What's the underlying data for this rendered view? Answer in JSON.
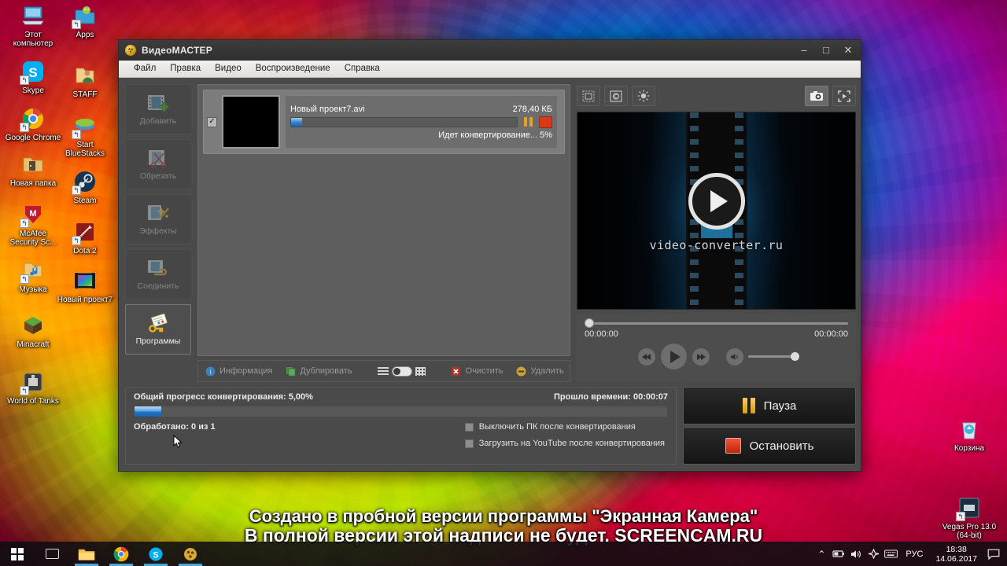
{
  "desktop": {
    "icons_left": [
      {
        "label": "Этот компьютер",
        "icon": "computer-icon",
        "shortcut": false
      },
      {
        "label": "Apps",
        "icon": "folder-apps-icon",
        "shortcut": true
      },
      {
        "label": "Skype",
        "icon": "skype-icon",
        "shortcut": true
      },
      {
        "label": "STAFF",
        "icon": "folder-staff-icon",
        "shortcut": false
      },
      {
        "label": "Google Chrome",
        "icon": "chrome-icon",
        "shortcut": true
      },
      {
        "label": "Start BlueStacks",
        "icon": "bluestacks-icon",
        "shortcut": true
      },
      {
        "label": "Новая папка",
        "icon": "folder-icon",
        "shortcut": false
      },
      {
        "label": "Steam",
        "icon": "steam-icon",
        "shortcut": true
      },
      {
        "label": "McAfee Security Sc...",
        "icon": "mcafee-icon",
        "shortcut": true
      },
      {
        "label": "Dota 2",
        "icon": "dota2-icon",
        "shortcut": true
      },
      {
        "label": "Музыка",
        "icon": "music-folder-icon",
        "shortcut": true
      },
      {
        "label": "Новый проект7",
        "icon": "video-file-icon",
        "shortcut": false
      },
      {
        "label": "Minacraft",
        "icon": "minecraft-icon",
        "shortcut": false
      },
      {
        "label": "World of Tanks",
        "icon": "wot-icon",
        "shortcut": true
      }
    ],
    "icons_right": [
      {
        "label": "Корзина",
        "icon": "recycle-bin-icon",
        "shortcut": false
      },
      {
        "label": "Vegas Pro 13.0 (64-bit)",
        "icon": "vegas-pro-icon",
        "shortcut": true
      }
    ]
  },
  "watermark": {
    "line1": "Создано в пробной версии программы \"Экранная Камера\"",
    "line2": "В полной версии этой надписи не будет. SCREENCAM.RU"
  },
  "window": {
    "title": "ВидеоМАСТЕР",
    "app_icon": "film-reel-icon",
    "controls": {
      "minimize": "–",
      "maximize": "□",
      "close": "✕"
    },
    "menu": [
      "Файл",
      "Правка",
      "Видео",
      "Воспроизведение",
      "Справка"
    ]
  },
  "sidebar": {
    "items": [
      {
        "label": "Добавить",
        "icon": "add-video-icon",
        "state": "disabled"
      },
      {
        "label": "Обрезать",
        "icon": "cut-video-icon",
        "state": "disabled"
      },
      {
        "label": "Эффекты",
        "icon": "effects-icon",
        "state": "disabled"
      },
      {
        "label": "Соединить",
        "icon": "join-video-icon",
        "state": "disabled"
      },
      {
        "label": "Программы",
        "icon": "programs-key-icon",
        "state": "active"
      }
    ]
  },
  "file_list": {
    "items": [
      {
        "checked": true,
        "name": "Новый проект7.avi",
        "size": "278,40 КБ",
        "progress_percent": 5,
        "status": "Идет конвертирование... 5%",
        "pause_icon": "pause-icon",
        "stop_icon": "stop-icon"
      }
    ],
    "toolbar": {
      "info": "Информация",
      "duplicate": "Дублировать",
      "clear": "Очистить",
      "delete": "Удалить",
      "view_list_icon": "list-view-icon",
      "view_toggle_icon": "view-toggle-switch",
      "view_grid_icon": "grid-view-icon"
    }
  },
  "preview": {
    "toolbar_left": [
      {
        "icon": "crop-frame-icon"
      },
      {
        "icon": "watermark-icon"
      },
      {
        "icon": "brightness-icon"
      }
    ],
    "toolbar_right": [
      {
        "icon": "snapshot-camera-icon"
      },
      {
        "icon": "fullscreen-icon"
      }
    ],
    "screen": {
      "play_icon": "play-button-icon",
      "url_text": "video-converter.ru"
    },
    "time_current": "00:00:00",
    "time_total": "00:00:00",
    "transport": {
      "prev_icon": "skip-back-icon",
      "play_icon": "play-icon",
      "next_icon": "skip-forward-icon",
      "volume_icon": "volume-icon"
    }
  },
  "status": {
    "overall_progress_label": "Общий прогресс конвертирования: 5,00%",
    "overall_progress_percent": 5,
    "elapsed_label": "Прошло времени: 00:00:07",
    "processed_label": "Обработано: 0 из 1",
    "checkbox_shutdown": "Выключить ПК после конвертирования",
    "checkbox_youtube": "Загрузить на YouTube после конвертирования"
  },
  "actions": {
    "pause": "Пауза",
    "stop": "Остановить"
  },
  "taskbar": {
    "start_icon": "windows-start-icon",
    "taskview_icon": "task-view-icon",
    "apps": [
      {
        "icon": "file-explorer-icon",
        "running": true
      },
      {
        "icon": "chrome-icon",
        "running": true
      },
      {
        "icon": "skype-icon",
        "running": true
      },
      {
        "icon": "videomaster-icon",
        "running": true
      }
    ],
    "tray": {
      "chevron": "⌃",
      "battery_icon": "battery-icon",
      "volume_icon": "volume-icon",
      "network_icon": "network-icon",
      "keyboard_icon": "keyboard-icon",
      "language": "РУС",
      "time": "18:38",
      "date": "14.06.2017",
      "notifications_icon": "notifications-icon"
    }
  }
}
